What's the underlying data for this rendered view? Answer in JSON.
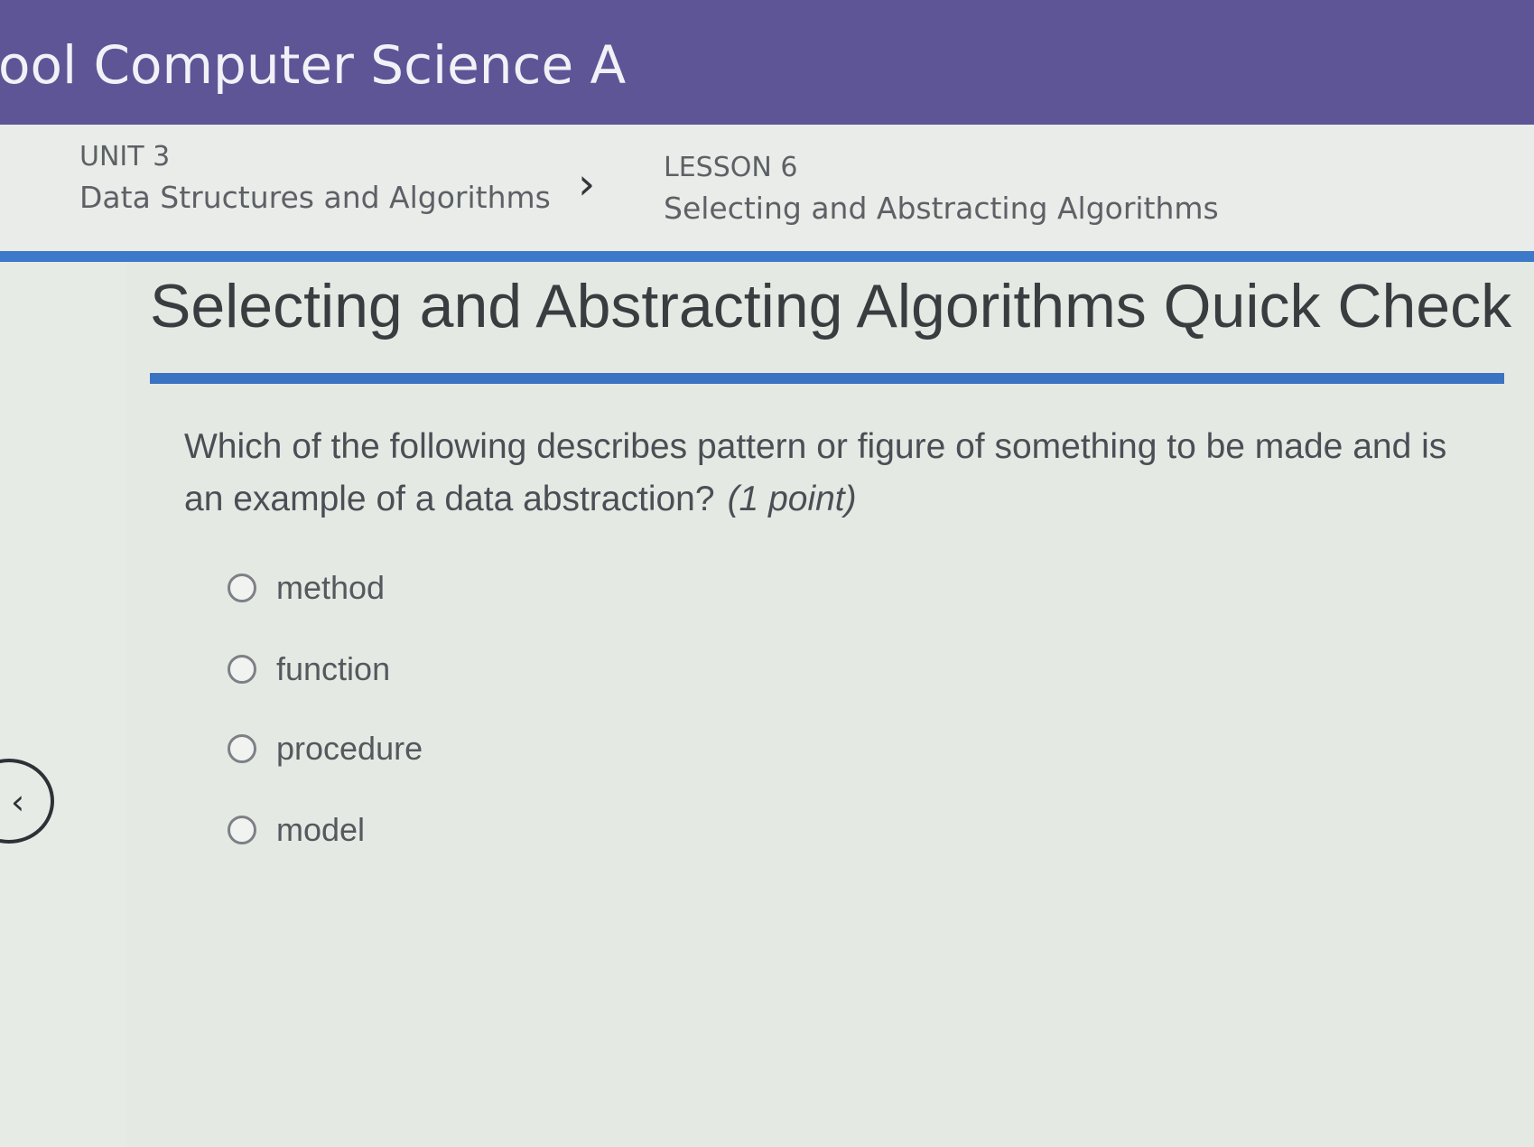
{
  "header": {
    "course_title": "ool Computer Science A"
  },
  "breadcrumb": {
    "unit": {
      "kicker": "UNIT 3",
      "label": "Data Structures and Algorithms"
    },
    "separator_icon": "chevron-right-icon",
    "lesson": {
      "kicker": "LESSON 6",
      "label": "Selecting and Abstracting Algorithms"
    }
  },
  "quiz": {
    "title": "Selecting and Abstracting Algorithms Quick Check",
    "question": "Which of the following describes pattern or figure of something to be made and is an example of a data abstraction?",
    "points": "(1 point)",
    "options": [
      {
        "label": "method",
        "selected": false
      },
      {
        "label": "function",
        "selected": false
      },
      {
        "label": "procedure",
        "selected": false
      },
      {
        "label": "model",
        "selected": false
      }
    ]
  },
  "nav": {
    "back_icon": "chevron-left-icon"
  },
  "colors": {
    "header_bg": "#5e5596",
    "accent_blue": "#3d79c9",
    "page_bg": "#e7ebe6"
  }
}
